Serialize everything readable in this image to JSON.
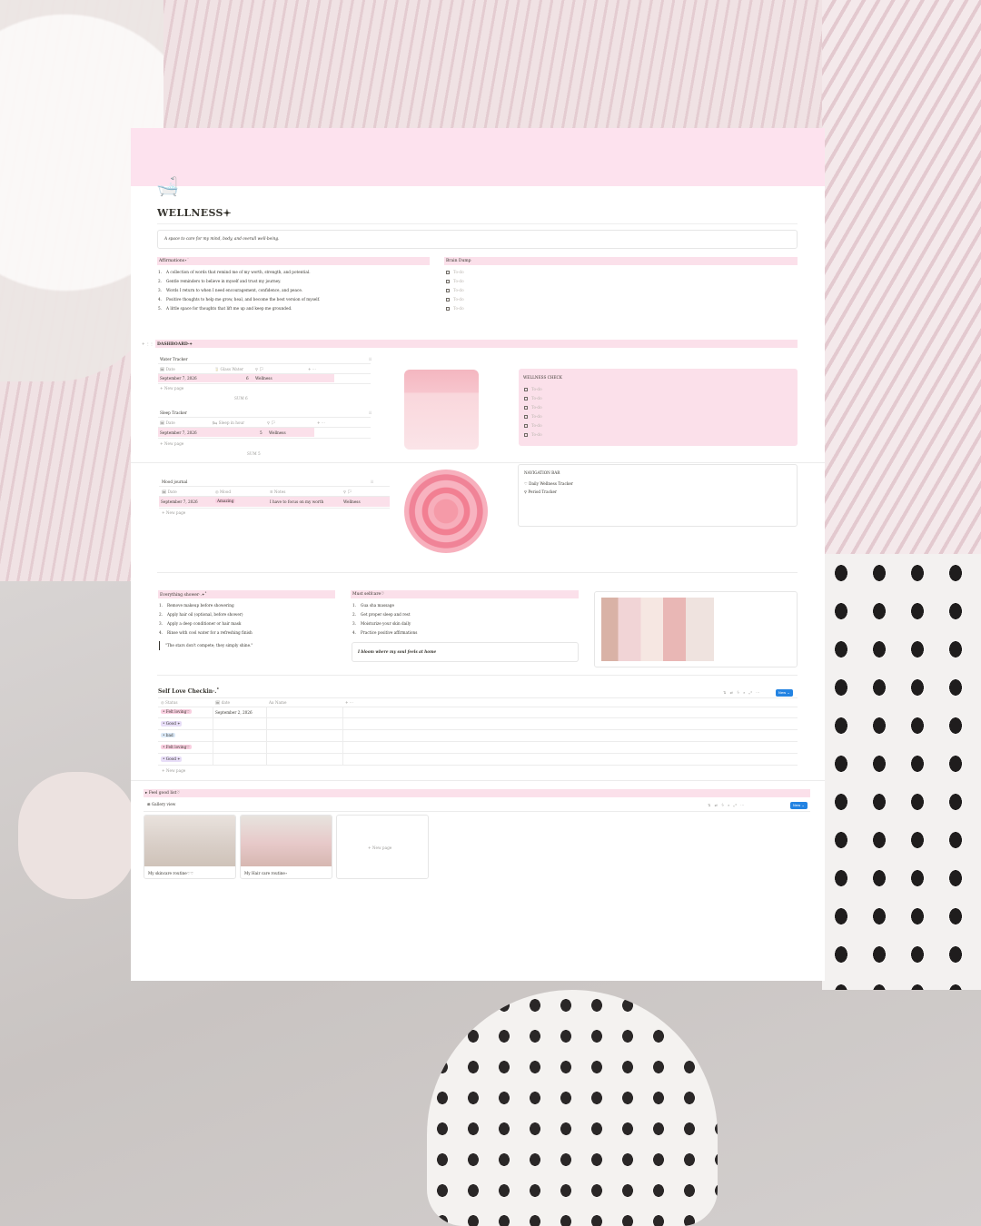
{
  "page": {
    "icon": "🛁",
    "title": "WELLNESS𖥔",
    "callout": "A space to care for my mind, body, and overall well-being."
  },
  "affirmations": {
    "heading": "Affirmations⋆˙",
    "items": [
      "A collection of words that remind me of my worth, strength, and potential.",
      "Gentle reminders to believe in myself and trust my journey.",
      "Words I return to when I need encouragement, confidence, and peace.",
      "Positive thoughts to help me grow, heal, and become the best version of myself.",
      "A little space for thoughts that lift me up and keep me grounded."
    ]
  },
  "brain_dump": {
    "heading": "Brain Dump",
    "todos": [
      "To-do",
      "To-do",
      "To-do",
      "To-do",
      "To-do"
    ]
  },
  "dashboard": {
    "heading": "DASHBOARD·𖥔",
    "water": {
      "title": "Water Tracker",
      "col_date": "Date",
      "col_qty": "Glass Water",
      "col_tag": "",
      "row_date": "September 7, 2026",
      "row_qty": "6",
      "row_tag": "Wellness",
      "new_page": "+ New page",
      "sum": "SUM 6"
    },
    "sleep": {
      "title": "Sleep Tracker",
      "col_date": "Date",
      "col_qty": "Sleep in hour",
      "col_tag": "",
      "row_date": "September 7, 2026",
      "row_qty": "5",
      "row_tag": "Wellness",
      "new_page": "+ New page",
      "sum": "SUM 5"
    },
    "wellness_check": {
      "title": "WELLNESS CHECK",
      "todos": [
        "To-do",
        "To-do",
        "To-do",
        "To-do",
        "To-do",
        "To-do"
      ]
    },
    "mood": {
      "title": "Mood journal",
      "col_date": "Date",
      "col_mood": "Mood",
      "col_notes": "Notes",
      "col_tag": "",
      "row_date": "September 7, 2026",
      "row_mood": "Amazing",
      "row_notes": "I have to focus on my worth",
      "row_tag": "Wellness",
      "new_page": "+ New page"
    },
    "navigation": {
      "title": "NAVIGATION BAR",
      "links": [
        "♡ Daily Wellness Tracker",
        "⚲ Period Tracker"
      ]
    }
  },
  "shower": {
    "heading": "Everything shower·.𖥔˚",
    "items": [
      "Remove makeup before showering",
      "Apply hair oil (optional, before shower)",
      "Apply a deep conditioner or hair mask",
      "Rinse with cool water for a refreshing finish"
    ],
    "quote": "\"The stars don't compete; they simply shine.\""
  },
  "selfcare": {
    "heading": "Must selfcare♡",
    "items": [
      "Gua sha massage",
      "Get proper sleep and rest",
      "Moisturize your skin daily",
      "Practice positive affirmations"
    ],
    "callout": "I bloom where my soul feels at home"
  },
  "checkin": {
    "title": "Self Love Checkin·.˚",
    "col_status": "Status",
    "col_date": "date",
    "col_name": "Name",
    "rows": [
      {
        "status": "• Felt loving♡",
        "date": "September 2, 2026",
        "style": "pink"
      },
      {
        "status": "• Good 𖥔",
        "date": "",
        "style": "purple"
      },
      {
        "status": "• bad",
        "date": "",
        "style": "blue"
      },
      {
        "status": "• Felt loving♡",
        "date": "",
        "style": "pink"
      },
      {
        "status": "• Good 𖥔",
        "date": "",
        "style": "purple"
      }
    ],
    "new_page": "+ New page",
    "new_button": "New ⌄"
  },
  "feel_good": {
    "heading": "▸  Feel good list♡",
    "view": "⊞ Gallery view",
    "cards": [
      "My skincare routine♡♡",
      "My Hair care routine⋆"
    ],
    "new_page": "+ New page",
    "new_button": "New ⌄"
  },
  "colors": {
    "accent_pink": "#fbe0ea",
    "cover_pink": "#fde2ee",
    "new_button_blue": "#2383e2"
  }
}
